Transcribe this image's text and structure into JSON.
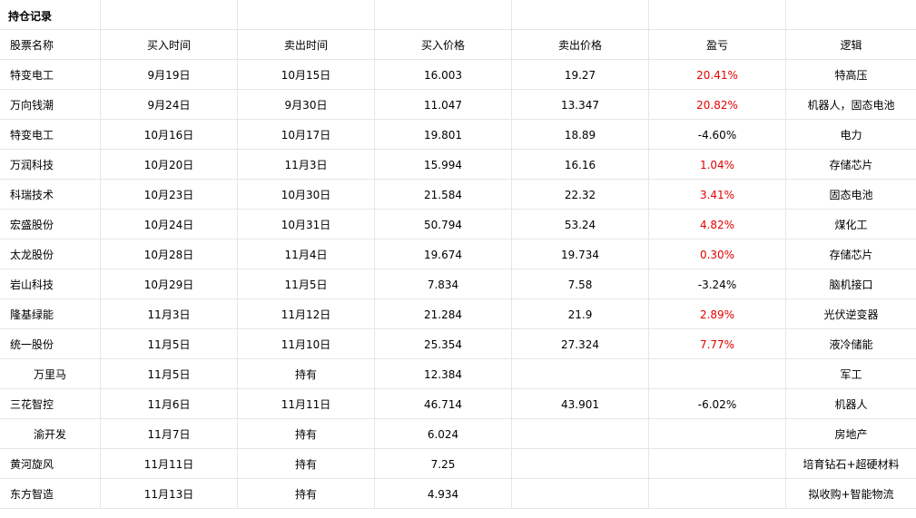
{
  "sheet": {
    "title": "持仓记录",
    "headers": [
      "股票名称",
      "买入时间",
      "卖出时间",
      "买入价格",
      "卖出价格",
      "盈亏",
      "逻辑"
    ],
    "rows": [
      {
        "name": "特变电工",
        "buy_date": "9月19日",
        "sell_date": "10月15日",
        "buy_price": "16.003",
        "sell_price": "19.27",
        "pnl": "20.41%",
        "pnl_color": "#e60000",
        "logic": "特高压",
        "name_align": "left"
      },
      {
        "name": "万向钱潮",
        "buy_date": "9月24日",
        "sell_date": "9月30日",
        "buy_price": "11.047",
        "sell_price": "13.347",
        "pnl": "20.82%",
        "pnl_color": "#e60000",
        "logic": "机器人，固态电池",
        "name_align": "left"
      },
      {
        "name": "特变电工",
        "buy_date": "10月16日",
        "sell_date": "10月17日",
        "buy_price": "19.801",
        "sell_price": "18.89",
        "pnl": "-4.60%",
        "pnl_color": "#000000",
        "logic": "电力",
        "name_align": "left"
      },
      {
        "name": "万润科技",
        "buy_date": "10月20日",
        "sell_date": "11月3日",
        "buy_price": "15.994",
        "sell_price": "16.16",
        "pnl": "1.04%",
        "pnl_color": "#e60000",
        "logic": "存储芯片",
        "name_align": "left"
      },
      {
        "name": "科瑞技术",
        "buy_date": "10月23日",
        "sell_date": "10月30日",
        "buy_price": "21.584",
        "sell_price": "22.32",
        "pnl": "3.41%",
        "pnl_color": "#e60000",
        "logic": "固态电池",
        "name_align": "left"
      },
      {
        "name": "宏盛股份",
        "buy_date": "10月24日",
        "sell_date": "10月31日",
        "buy_price": "50.794",
        "sell_price": "53.24",
        "pnl": "4.82%",
        "pnl_color": "#e60000",
        "logic": "煤化工",
        "name_align": "left"
      },
      {
        "name": "太龙股份",
        "buy_date": "10月28日",
        "sell_date": "11月4日",
        "buy_price": "19.674",
        "sell_price": "19.734",
        "pnl": "0.30%",
        "pnl_color": "#e60000",
        "logic": "存储芯片",
        "name_align": "left"
      },
      {
        "name": "岩山科技",
        "buy_date": "10月29日",
        "sell_date": "11月5日",
        "buy_price": "7.834",
        "sell_price": "7.58",
        "pnl": "-3.24%",
        "pnl_color": "#000000",
        "logic": "脑机接口",
        "name_align": "left"
      },
      {
        "name": "隆基绿能",
        "buy_date": "11月3日",
        "sell_date": "11月12日",
        "buy_price": "21.284",
        "sell_price": "21.9",
        "pnl": "2.89%",
        "pnl_color": "#e60000",
        "logic": "光伏逆变器",
        "name_align": "left"
      },
      {
        "name": "统一股份",
        "buy_date": "11月5日",
        "sell_date": "11月10日",
        "buy_price": "25.354",
        "sell_price": "27.324",
        "pnl": "7.77%",
        "pnl_color": "#e60000",
        "logic": "液冷储能",
        "name_align": "left"
      },
      {
        "name": "万里马",
        "buy_date": "11月5日",
        "sell_date": "持有",
        "buy_price": "12.384",
        "sell_price": "",
        "pnl": "",
        "pnl_color": "#000000",
        "logic": "军工",
        "name_align": "center"
      },
      {
        "name": "三花智控",
        "buy_date": "11月6日",
        "sell_date": "11月11日",
        "buy_price": "46.714",
        "sell_price": "43.901",
        "pnl": "-6.02%",
        "pnl_color": "#000000",
        "logic": "机器人",
        "name_align": "left"
      },
      {
        "name": "渝开发",
        "buy_date": "11月7日",
        "sell_date": "持有",
        "buy_price": "6.024",
        "sell_price": "",
        "pnl": "",
        "pnl_color": "#000000",
        "logic": "房地产",
        "name_align": "center"
      },
      {
        "name": "黄河旋风",
        "buy_date": "11月11日",
        "sell_date": "持有",
        "buy_price": "7.25",
        "sell_price": "",
        "pnl": "",
        "pnl_color": "#000000",
        "logic": "培育钻石+超硬材料",
        "name_align": "left"
      },
      {
        "name": "东方智造",
        "buy_date": "11月13日",
        "sell_date": "持有",
        "buy_price": "4.934",
        "sell_price": "",
        "pnl": "",
        "pnl_color": "#000000",
        "logic": "拟收购+智能物流",
        "name_align": "left"
      }
    ]
  }
}
